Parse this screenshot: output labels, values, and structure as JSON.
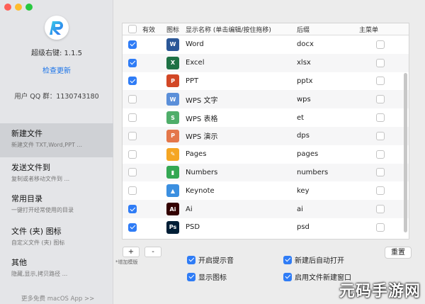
{
  "sidebar": {
    "version": "超级右键: 1.1.5",
    "update_link": "检查更新",
    "qq_group": "用户 QQ 群：1130743180",
    "nav": [
      {
        "title": "新建文件",
        "subtitle": "新建文件 TXT,Word,PPT ..."
      },
      {
        "title": "发送文件到",
        "subtitle": "复制或者移动文件到 ..."
      },
      {
        "title": "常用目录",
        "subtitle": "一键打开经常使用的目录"
      },
      {
        "title": "文件 (夹) 图标",
        "subtitle": "自定义文件 (夹) 图标"
      },
      {
        "title": "其他",
        "subtitle": "隐藏,显示,拷贝路径 ..."
      }
    ],
    "more_apps": "更多免费 macOS App >>"
  },
  "table": {
    "headers": {
      "enabled": "有效",
      "icon": "图标",
      "name": "显示名称 (单击编辑/按住拖移)",
      "suffix": "后缀",
      "main_menu": "主菜单"
    },
    "rows": [
      {
        "enabled": true,
        "icon": "word-icon",
        "icon_color": "#2b5797",
        "glyph": "W",
        "name": "Word",
        "suffix": "docx",
        "main_menu": false
      },
      {
        "enabled": true,
        "icon": "excel-icon",
        "icon_color": "#1e7145",
        "glyph": "X",
        "name": "Excel",
        "suffix": "xlsx",
        "main_menu": false
      },
      {
        "enabled": true,
        "icon": "powerpoint-icon",
        "icon_color": "#d24726",
        "glyph": "P",
        "name": "PPT",
        "suffix": "pptx",
        "main_menu": false
      },
      {
        "enabled": false,
        "icon": "wps-writer-icon",
        "icon_color": "#5b8fd9",
        "glyph": "W",
        "name": "WPS 文字",
        "suffix": "wps",
        "main_menu": false
      },
      {
        "enabled": false,
        "icon": "wps-sheet-icon",
        "icon_color": "#4fae6a",
        "glyph": "S",
        "name": "WPS 表格",
        "suffix": "et",
        "main_menu": false
      },
      {
        "enabled": false,
        "icon": "wps-present-icon",
        "icon_color": "#e4774a",
        "glyph": "P",
        "name": "WPS 演示",
        "suffix": "dps",
        "main_menu": false
      },
      {
        "enabled": false,
        "icon": "pages-icon",
        "icon_color": "#f5a623",
        "glyph": "✎",
        "name": "Pages",
        "suffix": "pages",
        "main_menu": false
      },
      {
        "enabled": false,
        "icon": "numbers-icon",
        "icon_color": "#34a853",
        "glyph": "▮",
        "name": "Numbers",
        "suffix": "numbers",
        "main_menu": false
      },
      {
        "enabled": false,
        "icon": "keynote-icon",
        "icon_color": "#3b8fe0",
        "glyph": "▲",
        "name": "Keynote",
        "suffix": "key",
        "main_menu": false
      },
      {
        "enabled": true,
        "icon": "illustrator-icon",
        "icon_color": "#330000",
        "glyph": "Ai",
        "name": "Ai",
        "suffix": "ai",
        "main_menu": false
      },
      {
        "enabled": true,
        "icon": "photoshop-icon",
        "icon_color": "#001e36",
        "glyph": "Ps",
        "name": "PSD",
        "suffix": "psd",
        "main_menu": false
      }
    ]
  },
  "controls": {
    "add": "+",
    "remove": "-",
    "add_hint": "*增加模版",
    "reset": "重置",
    "options": [
      {
        "id": "sound",
        "label": "开启提示音",
        "checked": true
      },
      {
        "id": "auto-open",
        "label": "新建后自动打开",
        "checked": true
      },
      {
        "id": "show-icon",
        "label": "显示图标",
        "checked": true
      },
      {
        "id": "new-window",
        "label": "启用文件新建窗口",
        "checked": true
      }
    ]
  },
  "watermark": "元码手游网",
  "colors": {
    "accent": "#2f7cf6",
    "link": "#1a73e8"
  }
}
